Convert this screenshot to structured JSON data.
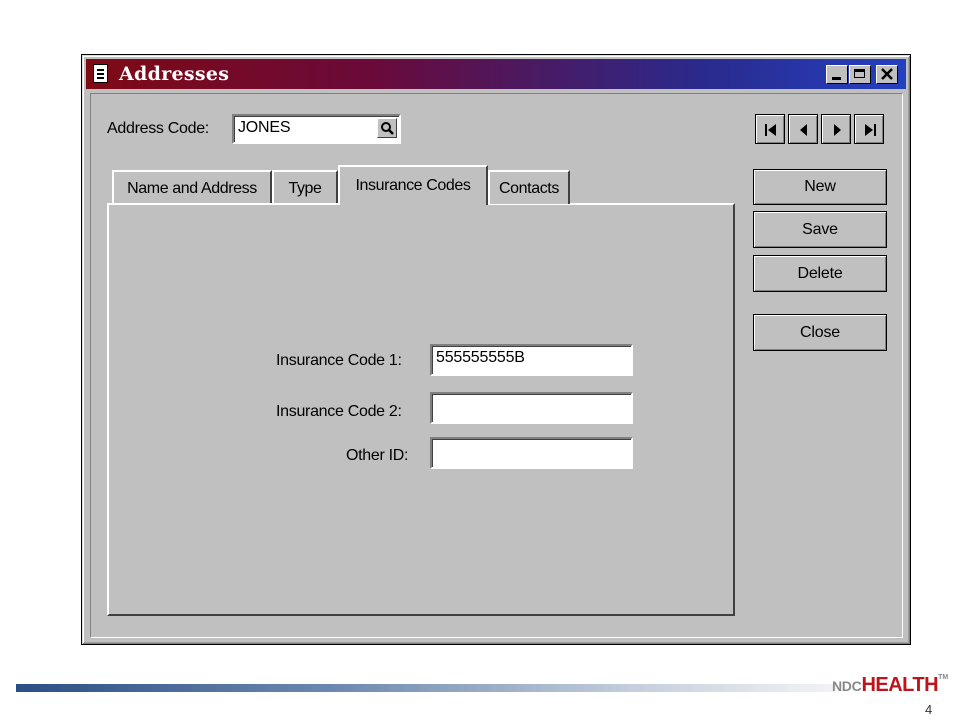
{
  "window": {
    "title": "Addresses"
  },
  "address_code": {
    "label": "Address Code:",
    "value": "JONES"
  },
  "navigation": [
    "first-record",
    "previous-record",
    "next-record",
    "last-record"
  ],
  "tabs": [
    {
      "label": "Name and Address",
      "active": false
    },
    {
      "label": "Type",
      "active": false
    },
    {
      "label": "Insurance Codes",
      "active": true
    },
    {
      "label": "Contacts",
      "active": false
    }
  ],
  "fields": {
    "insurance_code_1": {
      "label": "Insurance Code 1:",
      "value": "555555555B"
    },
    "insurance_code_2": {
      "label": "Insurance Code 2:",
      "value": ""
    },
    "other_id": {
      "label": "Other ID:",
      "value": ""
    }
  },
  "buttons": {
    "new": "New",
    "save": "Save",
    "delete": "Delete",
    "close": "Close"
  },
  "footer": {
    "logo_prefix": "NDC",
    "logo_main": "HEALTH",
    "logo_tm": "TM",
    "page_number": "4"
  },
  "colors": {
    "title_start": "#7e0a14",
    "title_end": "#2440c0",
    "window_bg": "#c0c0c0",
    "logo_red": "#c0141c"
  }
}
